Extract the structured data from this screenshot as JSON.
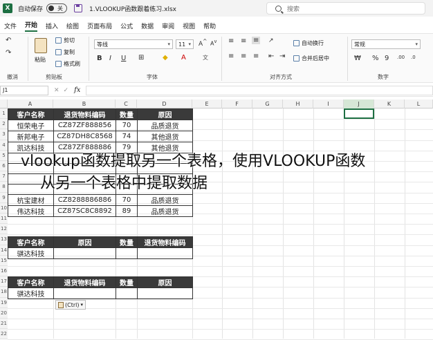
{
  "titlebar": {
    "autosave_label": "自动保存",
    "autosave_state": "关",
    "document_name": "1.VLOOKUP函数跟着练习.xlsx",
    "search_placeholder": "搜索"
  },
  "menu_tabs": [
    "文件",
    "开始",
    "插入",
    "绘图",
    "页面布局",
    "公式",
    "数据",
    "审阅",
    "视图",
    "帮助"
  ],
  "active_tab": "开始",
  "ribbon": {
    "paste_label": "粘贴",
    "cut_label": "剪切",
    "copy_label": "复制",
    "format_painter_label": "格式刷",
    "font_name": "等线",
    "font_size": "11",
    "wrap_text_label": "自动换行",
    "merge_center_label": "合并后居中",
    "number_format": "常规",
    "groups": {
      "undo": "撤消",
      "clipboard": "剪贴板",
      "font": "字体",
      "alignment": "对齐方式",
      "number": "数字"
    }
  },
  "formula_bar": {
    "name_box": "J1",
    "fx_label": "fx"
  },
  "columns": [
    "A",
    "B",
    "C",
    "D",
    "E",
    "F",
    "G",
    "H",
    "I",
    "J",
    "K",
    "L"
  ],
  "rows": [
    "1",
    "2",
    "3",
    "4",
    "5",
    "6",
    "7",
    "8",
    "9",
    "10",
    "11",
    "12",
    "13",
    "14",
    "15",
    "16",
    "17",
    "18",
    "19",
    "20",
    "21",
    "22"
  ],
  "table1": {
    "headers": [
      "客户名称",
      "退货物料编码",
      "数量",
      "原因"
    ],
    "rows": [
      [
        "恒荣电子",
        "CZ87ZF888856",
        "70",
        "品质退货"
      ],
      [
        "新邦电子",
        "CZ87DH8C8568",
        "74",
        "其他退货"
      ],
      [
        "凯达科技",
        "CZ87ZF888886",
        "79",
        "其他退货"
      ],
      [
        "",
        "",
        "",
        ""
      ],
      [
        "",
        "",
        "",
        ""
      ],
      [
        "",
        "",
        "",
        ""
      ],
      [
        "",
        "",
        "",
        ""
      ],
      [
        "杭宝建材",
        "CZ8288886886",
        "70",
        "品质退货"
      ],
      [
        "伟达科技",
        "CZ87SC8C8892",
        "89",
        "品质退货"
      ]
    ]
  },
  "table2": {
    "headers": [
      "客户名称",
      "原因",
      "数量",
      "退货物料编码"
    ],
    "rows": [
      [
        "骐达科技",
        "",
        "",
        ""
      ]
    ]
  },
  "table3": {
    "headers": [
      "客户名称",
      "退货物料编码",
      "数量",
      "原因"
    ],
    "rows": [
      [
        "骐达科技",
        "",
        "",
        ""
      ]
    ]
  },
  "paste_options_label": "(Ctrl)",
  "overlay_caption": {
    "line1": "vlookup函数提取另一个表格，使用VLOOKUP函数",
    "line2": "从另一个表格中提取数据"
  }
}
